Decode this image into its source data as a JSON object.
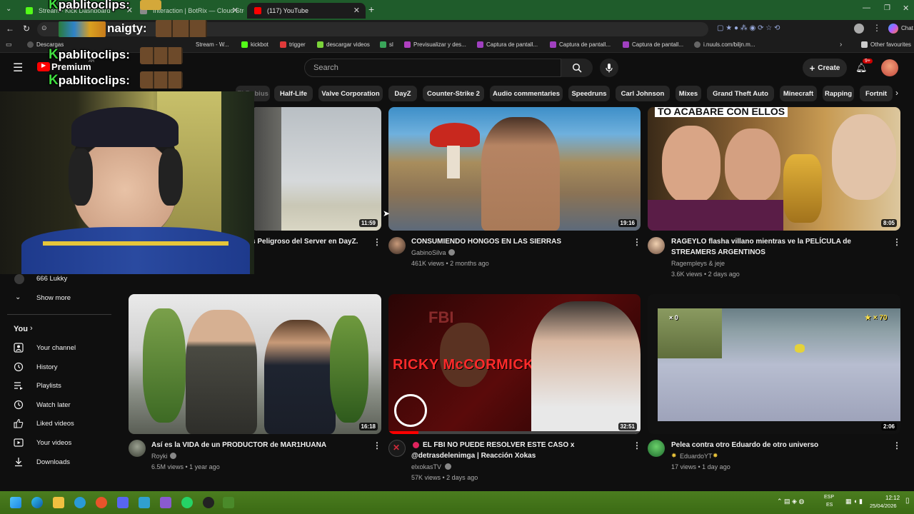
{
  "browser": {
    "tabs": [
      {
        "title": "Stream - Kick Dashboard",
        "color": "#53fc18"
      },
      {
        "title": "Interaction | BotRix — Cloud Strea",
        "color": "#8a8a8a"
      },
      {
        "title": "(117) YouTube",
        "color": "#ff0000"
      }
    ],
    "new_tab": "+",
    "address_text": "naigty:",
    "bookmarks": [
      {
        "label": "Descargas",
        "color": "#cccccc"
      },
      {
        "label": "Stream - W...",
        "color": "#888888"
      },
      {
        "label": "kickbot",
        "color": "#53fc18"
      },
      {
        "label": "trigger",
        "color": "#e03a3a"
      },
      {
        "label": "descargar videos",
        "color": "#7bd43a"
      },
      {
        "label": "sl",
        "color": "#3aa55a"
      },
      {
        "label": "Previsualizar y des...",
        "color": "#b040c0"
      },
      {
        "label": "Captura de pantall...",
        "color": "#a040c0"
      },
      {
        "label": "Captura de pantall...",
        "color": "#a040c0"
      },
      {
        "label": "Captura de pantall...",
        "color": "#a040c0"
      },
      {
        "label": "i.nuuls.com/biljn.m...",
        "color": "#cccccc"
      }
    ],
    "other_favourites": "Other favourites",
    "chat_label": "Chat"
  },
  "youtube": {
    "logo_text": "Premium",
    "logo_region": "AR",
    "search_placeholder": "Search",
    "create_label": "Create",
    "notification_count": "9+",
    "chips": [
      "Half-Life",
      "Valve Corporation",
      "DayZ",
      "Counter-Strike 2",
      "Audio commentaries",
      "Speedruns",
      "Carl Johnson",
      "Mixes",
      "Grand Theft Auto",
      "Minecraft",
      "Rapping",
      "Fortnit"
    ],
    "chips_partial": [
      "El Rubius"
    ],
    "sidebar": {
      "subscription_partial": "666 Lukky",
      "show_more": "Show more",
      "you_header": "You",
      "items": [
        {
          "label": "Your channel",
          "icon": "person-icon"
        },
        {
          "label": "History",
          "icon": "history-icon"
        },
        {
          "label": "Playlists",
          "icon": "playlists-icon"
        },
        {
          "label": "Watch later",
          "icon": "clock-icon"
        },
        {
          "label": "Liked videos",
          "icon": "thumbs-up-icon"
        },
        {
          "label": "Your videos",
          "icon": "video-icon"
        },
        {
          "label": "Downloads",
          "icon": "download-icon"
        }
      ]
    },
    "videos": [
      {
        "title": "s Peligroso del Server en DayZ.",
        "channel": "",
        "meta": "",
        "duration": "11:59",
        "verified": false
      },
      {
        "title": "CONSUMIENDO HONGOS EN LAS SIERRAS",
        "channel": "GabinoSilva",
        "meta": "461K views • 2 months ago",
        "duration": "19:16",
        "verified": true
      },
      {
        "title": "RAGEYLO flasha villano mientras ve la PELÍCULA de STREAMERS ARGENTINOS",
        "channel": "Ragempleys & jeje",
        "meta": "3.6K views • 2 days ago",
        "duration": "8:05",
        "verified": false
      },
      {
        "title": "Así es la VIDA de un PRODUCTOR de MAR1HUANA",
        "channel": "Royki",
        "meta": "6.5M views • 1 year ago",
        "duration": "16:18",
        "verified": true
      },
      {
        "title": "EL FBI NO PUEDE RESOLVER ESTE CASO x @detrasdelenimga | Reacción Xokas",
        "channel": "elxokasTV",
        "meta": "57K views • 2 days ago",
        "duration": "32:51",
        "verified": true
      },
      {
        "title": "Pelea contra otro Eduardo de otro universo",
        "channel": "EduardoYT",
        "meta": "17 views • 1 day ago",
        "duration": "2:06",
        "verified": false
      }
    ],
    "thumbnail_texts": {
      "fbi_banner": "RICKY McCORMICK",
      "fbi_tag": "FBI",
      "rageylo_caption": "TO ACABARE CON ELLOS",
      "mario_stars": "★ × 70",
      "mario_lives": "× 0"
    }
  },
  "overlay": {
    "chat": [
      {
        "user": "pablitoclips:"
      },
      {
        "user": "naigty:"
      },
      {
        "user": "pablitoclips:"
      },
      {
        "user": "pablitoclips:"
      }
    ]
  },
  "taskbar": {
    "lang_top": "ESP",
    "lang_bottom": "ES",
    "time": "12:12",
    "date": "25/04/2026"
  }
}
